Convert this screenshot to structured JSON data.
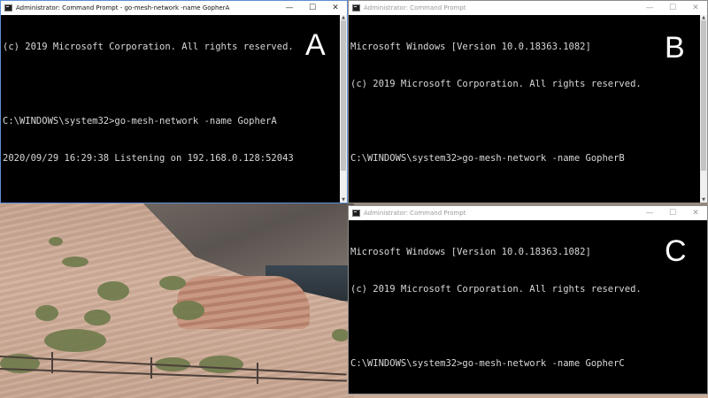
{
  "windows": {
    "a": {
      "title": "Administrator: Command Prompt - go-mesh-network  -name GopherA",
      "label": "A",
      "lines": [
        "(c) 2019 Microsoft Corporation. All rights reserved.",
        "",
        "C:\\WINDOWS\\system32>go-mesh-network -name GopherA",
        "2020/09/29 16:29:38 Listening on 192.168.0.128:52043"
      ]
    },
    "b": {
      "title": "Administrator: Command Prompt",
      "label": "B",
      "lines": [
        "Microsoft Windows [Version 10.0.18363.1082]",
        "(c) 2019 Microsoft Corporation. All rights reserved.",
        "",
        "C:\\WINDOWS\\system32>go-mesh-network -name GopherB"
      ]
    },
    "c": {
      "title": "Administrator: Command Prompt",
      "label": "C",
      "lines": [
        "Microsoft Windows [Version 10.0.18363.1082]",
        "(c) 2019 Microsoft Corporation. All rights reserved.",
        "",
        "C:\\WINDOWS\\system32>go-mesh-network -name GopherC"
      ]
    }
  },
  "controls": {
    "minimize": "—",
    "maximize": "☐",
    "close": "✕"
  },
  "colors": {
    "console_bg": "#000000",
    "console_text": "#d8d8d8",
    "active_border": "#5b8fd6"
  }
}
